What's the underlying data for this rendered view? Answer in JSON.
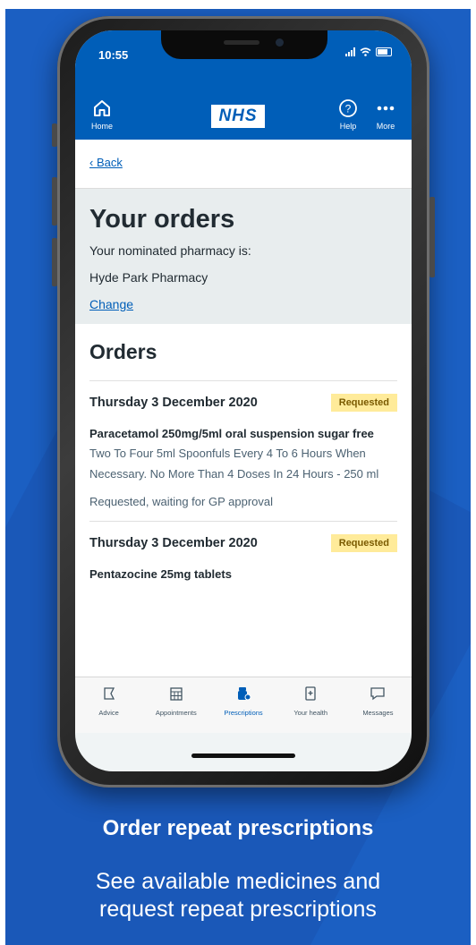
{
  "status": {
    "time": "10:55"
  },
  "header": {
    "home_label": "Home",
    "logo_text": "NHS",
    "help_label": "Help",
    "more_label": "More"
  },
  "nav": {
    "back_label": "Back"
  },
  "intro": {
    "title": "Your orders",
    "pharmacy_prompt": "Your nominated pharmacy is:",
    "pharmacy_name": "Hyde Park Pharmacy",
    "change_label": "Change"
  },
  "orders": {
    "heading": "Orders",
    "items": [
      {
        "date": "Thursday 3 December 2020",
        "status_tag": "Requested",
        "medicine": "Paracetamol 250mg/5ml oral suspension sugar free",
        "directions": "Two To Four 5ml Spoonfuls Every 4 To 6 Hours When Necessary. No More Than 4 Doses In 24 Hours - 250 ml",
        "status_text": "Requested, waiting for GP approval"
      },
      {
        "date": "Thursday 3 December 2020",
        "status_tag": "Requested",
        "medicine": "Pentazocine 25mg tablets"
      }
    ]
  },
  "bottom_nav": [
    {
      "label": "Advice",
      "icon": "advice-icon"
    },
    {
      "label": "Appointments",
      "icon": "calendar-icon"
    },
    {
      "label": "Prescriptions",
      "icon": "prescriptions-icon",
      "active": true
    },
    {
      "label": "Your health",
      "icon": "health-record-icon"
    },
    {
      "label": "Messages",
      "icon": "messages-icon"
    }
  ],
  "caption": {
    "title": "Order repeat prescriptions",
    "subtitle_line1": "See available medicines and",
    "subtitle_line2": "request repeat prescriptions"
  },
  "colors": {
    "nhs_blue": "#005eb8",
    "background_blue": "#1b5fc2",
    "requested_tag": "#ffeb9a"
  }
}
